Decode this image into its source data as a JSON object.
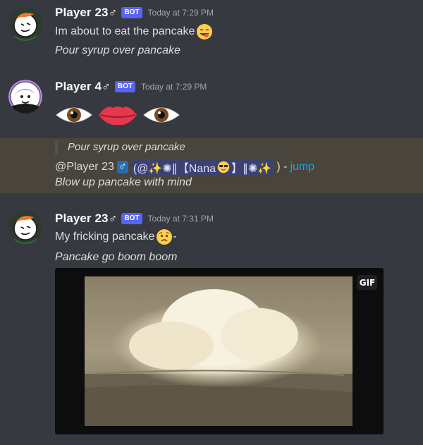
{
  "messages": [
    {
      "author": "Player 23♂",
      "badge": "BOT",
      "time": "Today at 7:29 PM",
      "text": "Im about to eat the pancake",
      "action": "Pour syrup over pancake"
    },
    {
      "author": "Player 4♂",
      "badge": "BOT",
      "time": "Today at 7:29 PM",
      "emoji": [
        "eye",
        "lips",
        "eye"
      ]
    },
    {
      "quoted": "Pour syrup over pancake",
      "mention_prefix": "@Player 23",
      "mention_chip_text": "(@✨✺∥【Nana",
      "mention_chip_tail": "】∥✺✨",
      "mention_suffix": ") -",
      "jump": "jump",
      "action": "Blow up pancake with mind"
    },
    {
      "author": "Player 23♂",
      "badge": "BOT",
      "time": "Today at 7:31 PM",
      "text": "My fricking pancake",
      "text_tail": "-",
      "action": "Pancake go boom boom",
      "gif_label": "GIF"
    }
  ],
  "colors": {
    "background": "#36393f",
    "bot_badge": "#5865f2",
    "highlight": "#49443c",
    "link": "#00aff4"
  }
}
